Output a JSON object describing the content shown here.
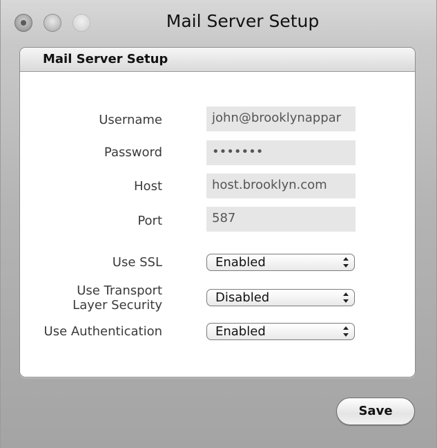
{
  "window": {
    "title": "Mail Server Setup"
  },
  "panel": {
    "title": "Mail Server Setup"
  },
  "form": {
    "username": {
      "label": "Username",
      "value": "john@brooklynappar"
    },
    "password": {
      "label": "Password",
      "value": "•••••••"
    },
    "host": {
      "label": "Host",
      "value": "host.brooklyn.com"
    },
    "port": {
      "label": "Port",
      "value": "587"
    },
    "use_ssl": {
      "label": "Use SSL",
      "value": "Enabled"
    },
    "use_tls": {
      "label_line1": "Use Transport",
      "label_line2": "Layer Security",
      "value": "Disabled"
    },
    "use_auth": {
      "label": "Use Authentication",
      "value": "Enabled"
    }
  },
  "actions": {
    "save_label": "Save"
  },
  "icons": {
    "close": "close-traffic-light-icon",
    "minimize": "minimize-traffic-light-icon",
    "zoom": "zoom-traffic-light-icon",
    "popup_arrows": "up-down-arrows-icon"
  }
}
